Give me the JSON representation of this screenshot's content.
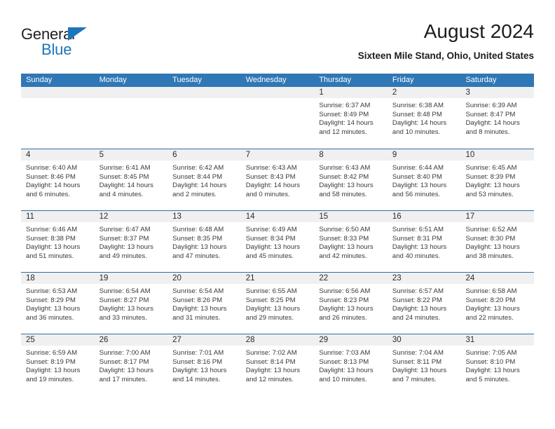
{
  "brand": {
    "name_part1": "General",
    "name_part2": "Blue",
    "triangle_color": "#1b76bc",
    "text_color": "#231f20"
  },
  "header": {
    "title": "August 2024",
    "location": "Sixteen Mile Stand, Ohio, United States"
  },
  "theme": {
    "header_blue": "#3077b5",
    "row_divider_blue": "#2e6da4",
    "day_band_gray": "#f0f0f0"
  },
  "weekday_headers": [
    "Sunday",
    "Monday",
    "Tuesday",
    "Wednesday",
    "Thursday",
    "Friday",
    "Saturday"
  ],
  "weeks": [
    [
      {
        "day": "",
        "sunrise": "",
        "sunset": "",
        "daylight_line1": "",
        "daylight_line2": ""
      },
      {
        "day": "",
        "sunrise": "",
        "sunset": "",
        "daylight_line1": "",
        "daylight_line2": ""
      },
      {
        "day": "",
        "sunrise": "",
        "sunset": "",
        "daylight_line1": "",
        "daylight_line2": ""
      },
      {
        "day": "",
        "sunrise": "",
        "sunset": "",
        "daylight_line1": "",
        "daylight_line2": ""
      },
      {
        "day": "1",
        "sunrise": "Sunrise: 6:37 AM",
        "sunset": "Sunset: 8:49 PM",
        "daylight_line1": "Daylight: 14 hours",
        "daylight_line2": "and 12 minutes."
      },
      {
        "day": "2",
        "sunrise": "Sunrise: 6:38 AM",
        "sunset": "Sunset: 8:48 PM",
        "daylight_line1": "Daylight: 14 hours",
        "daylight_line2": "and 10 minutes."
      },
      {
        "day": "3",
        "sunrise": "Sunrise: 6:39 AM",
        "sunset": "Sunset: 8:47 PM",
        "daylight_line1": "Daylight: 14 hours",
        "daylight_line2": "and 8 minutes."
      }
    ],
    [
      {
        "day": "4",
        "sunrise": "Sunrise: 6:40 AM",
        "sunset": "Sunset: 8:46 PM",
        "daylight_line1": "Daylight: 14 hours",
        "daylight_line2": "and 6 minutes."
      },
      {
        "day": "5",
        "sunrise": "Sunrise: 6:41 AM",
        "sunset": "Sunset: 8:45 PM",
        "daylight_line1": "Daylight: 14 hours",
        "daylight_line2": "and 4 minutes."
      },
      {
        "day": "6",
        "sunrise": "Sunrise: 6:42 AM",
        "sunset": "Sunset: 8:44 PM",
        "daylight_line1": "Daylight: 14 hours",
        "daylight_line2": "and 2 minutes."
      },
      {
        "day": "7",
        "sunrise": "Sunrise: 6:43 AM",
        "sunset": "Sunset: 8:43 PM",
        "daylight_line1": "Daylight: 14 hours",
        "daylight_line2": "and 0 minutes."
      },
      {
        "day": "8",
        "sunrise": "Sunrise: 6:43 AM",
        "sunset": "Sunset: 8:42 PM",
        "daylight_line1": "Daylight: 13 hours",
        "daylight_line2": "and 58 minutes."
      },
      {
        "day": "9",
        "sunrise": "Sunrise: 6:44 AM",
        "sunset": "Sunset: 8:40 PM",
        "daylight_line1": "Daylight: 13 hours",
        "daylight_line2": "and 56 minutes."
      },
      {
        "day": "10",
        "sunrise": "Sunrise: 6:45 AM",
        "sunset": "Sunset: 8:39 PM",
        "daylight_line1": "Daylight: 13 hours",
        "daylight_line2": "and 53 minutes."
      }
    ],
    [
      {
        "day": "11",
        "sunrise": "Sunrise: 6:46 AM",
        "sunset": "Sunset: 8:38 PM",
        "daylight_line1": "Daylight: 13 hours",
        "daylight_line2": "and 51 minutes."
      },
      {
        "day": "12",
        "sunrise": "Sunrise: 6:47 AM",
        "sunset": "Sunset: 8:37 PM",
        "daylight_line1": "Daylight: 13 hours",
        "daylight_line2": "and 49 minutes."
      },
      {
        "day": "13",
        "sunrise": "Sunrise: 6:48 AM",
        "sunset": "Sunset: 8:35 PM",
        "daylight_line1": "Daylight: 13 hours",
        "daylight_line2": "and 47 minutes."
      },
      {
        "day": "14",
        "sunrise": "Sunrise: 6:49 AM",
        "sunset": "Sunset: 8:34 PM",
        "daylight_line1": "Daylight: 13 hours",
        "daylight_line2": "and 45 minutes."
      },
      {
        "day": "15",
        "sunrise": "Sunrise: 6:50 AM",
        "sunset": "Sunset: 8:33 PM",
        "daylight_line1": "Daylight: 13 hours",
        "daylight_line2": "and 42 minutes."
      },
      {
        "day": "16",
        "sunrise": "Sunrise: 6:51 AM",
        "sunset": "Sunset: 8:31 PM",
        "daylight_line1": "Daylight: 13 hours",
        "daylight_line2": "and 40 minutes."
      },
      {
        "day": "17",
        "sunrise": "Sunrise: 6:52 AM",
        "sunset": "Sunset: 8:30 PM",
        "daylight_line1": "Daylight: 13 hours",
        "daylight_line2": "and 38 minutes."
      }
    ],
    [
      {
        "day": "18",
        "sunrise": "Sunrise: 6:53 AM",
        "sunset": "Sunset: 8:29 PM",
        "daylight_line1": "Daylight: 13 hours",
        "daylight_line2": "and 36 minutes."
      },
      {
        "day": "19",
        "sunrise": "Sunrise: 6:54 AM",
        "sunset": "Sunset: 8:27 PM",
        "daylight_line1": "Daylight: 13 hours",
        "daylight_line2": "and 33 minutes."
      },
      {
        "day": "20",
        "sunrise": "Sunrise: 6:54 AM",
        "sunset": "Sunset: 8:26 PM",
        "daylight_line1": "Daylight: 13 hours",
        "daylight_line2": "and 31 minutes."
      },
      {
        "day": "21",
        "sunrise": "Sunrise: 6:55 AM",
        "sunset": "Sunset: 8:25 PM",
        "daylight_line1": "Daylight: 13 hours",
        "daylight_line2": "and 29 minutes."
      },
      {
        "day": "22",
        "sunrise": "Sunrise: 6:56 AM",
        "sunset": "Sunset: 8:23 PM",
        "daylight_line1": "Daylight: 13 hours",
        "daylight_line2": "and 26 minutes."
      },
      {
        "day": "23",
        "sunrise": "Sunrise: 6:57 AM",
        "sunset": "Sunset: 8:22 PM",
        "daylight_line1": "Daylight: 13 hours",
        "daylight_line2": "and 24 minutes."
      },
      {
        "day": "24",
        "sunrise": "Sunrise: 6:58 AM",
        "sunset": "Sunset: 8:20 PM",
        "daylight_line1": "Daylight: 13 hours",
        "daylight_line2": "and 22 minutes."
      }
    ],
    [
      {
        "day": "25",
        "sunrise": "Sunrise: 6:59 AM",
        "sunset": "Sunset: 8:19 PM",
        "daylight_line1": "Daylight: 13 hours",
        "daylight_line2": "and 19 minutes."
      },
      {
        "day": "26",
        "sunrise": "Sunrise: 7:00 AM",
        "sunset": "Sunset: 8:17 PM",
        "daylight_line1": "Daylight: 13 hours",
        "daylight_line2": "and 17 minutes."
      },
      {
        "day": "27",
        "sunrise": "Sunrise: 7:01 AM",
        "sunset": "Sunset: 8:16 PM",
        "daylight_line1": "Daylight: 13 hours",
        "daylight_line2": "and 14 minutes."
      },
      {
        "day": "28",
        "sunrise": "Sunrise: 7:02 AM",
        "sunset": "Sunset: 8:14 PM",
        "daylight_line1": "Daylight: 13 hours",
        "daylight_line2": "and 12 minutes."
      },
      {
        "day": "29",
        "sunrise": "Sunrise: 7:03 AM",
        "sunset": "Sunset: 8:13 PM",
        "daylight_line1": "Daylight: 13 hours",
        "daylight_line2": "and 10 minutes."
      },
      {
        "day": "30",
        "sunrise": "Sunrise: 7:04 AM",
        "sunset": "Sunset: 8:11 PM",
        "daylight_line1": "Daylight: 13 hours",
        "daylight_line2": "and 7 minutes."
      },
      {
        "day": "31",
        "sunrise": "Sunrise: 7:05 AM",
        "sunset": "Sunset: 8:10 PM",
        "daylight_line1": "Daylight: 13 hours",
        "daylight_line2": "and 5 minutes."
      }
    ]
  ]
}
